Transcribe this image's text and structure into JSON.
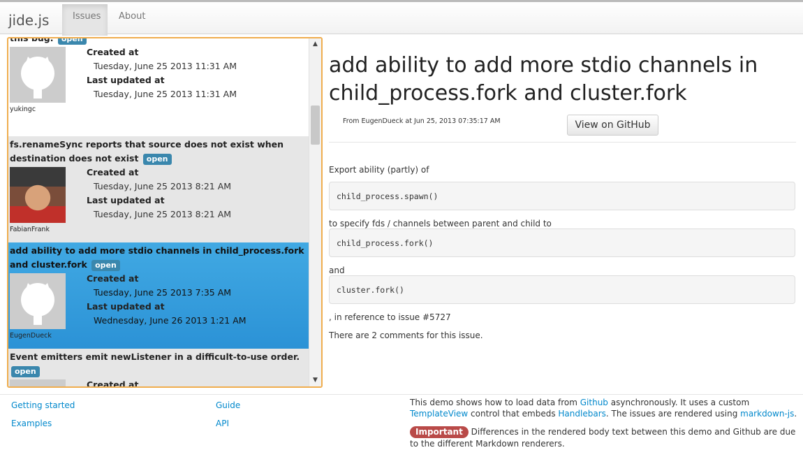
{
  "nav": {
    "brand": "jide.js",
    "tabs": [
      {
        "label": "Issues",
        "active": true
      },
      {
        "label": "About",
        "active": false
      }
    ]
  },
  "issues": [
    {
      "title": "this bug.",
      "state": "open",
      "author": "yukingc",
      "created_label": "Created at",
      "created": "Tuesday, June 25 2013 11:31 AM",
      "updated_label": "Last updated at",
      "updated": "Tuesday, June 25 2013 11:31 AM"
    },
    {
      "title": "fs.renameSync reports that source does not exist when destination does not exist",
      "state": "open",
      "author": "FabianFrank",
      "created_label": "Created at",
      "created": "Tuesday, June 25 2013 8:21 AM",
      "updated_label": "Last updated at",
      "updated": "Tuesday, June 25 2013 8:21 AM"
    },
    {
      "title": "add ability to add more stdio channels in child_process.fork and cluster.fork",
      "state": "open",
      "author": "EugenDueck",
      "created_label": "Created at",
      "created": "Tuesday, June 25 2013 7:35 AM",
      "updated_label": "Last updated at",
      "updated": "Wednesday, June 26 2013 1:21 AM"
    },
    {
      "title": "Event emitters emit newListener in a difficult-to-use order.",
      "state": "open",
      "author": "",
      "created_label": "Created at",
      "created": "",
      "updated_label": "",
      "updated": ""
    }
  ],
  "detail": {
    "title": "add ability to add more stdio channels in child_process.fork and cluster.fork",
    "from": "From EugenDueck at Jun 25, 2013 07:35:17 AM",
    "github_button": "View on GitHub",
    "p1": "Export ability (partly) of",
    "code1": "child_process.spawn()",
    "p2": "to specify fds / channels between parent and child to",
    "code2": "child_process.fork()",
    "p3": "and",
    "code3": "cluster.fork()",
    "p4": ", in reference to issue #5727",
    "comments": "There are 2 comments for this issue."
  },
  "footer": {
    "links": [
      "Getting started",
      "Guide",
      "Examples",
      "API"
    ],
    "note1_a": "This demo shows how to load data from ",
    "note1_link1": "Github",
    "note1_b": " asynchronously. It uses a custom ",
    "note1_link2": "TemplateView",
    "note1_c": " control that embeds ",
    "note1_link3": "Handlebars",
    "note1_d": ". The issues are rendered using ",
    "note1_link4": "markdown-js",
    "note1_e": ".",
    "important_label": "Important",
    "note2": " Differences in the rendered body text between this demo and Github are due to the different Markdown renderers."
  },
  "colors": {
    "active_item": "#2b92d6",
    "badge": "#3a87ad",
    "list_border": "#f0ad4e",
    "link": "#0088cc",
    "important": "#b94a48"
  }
}
